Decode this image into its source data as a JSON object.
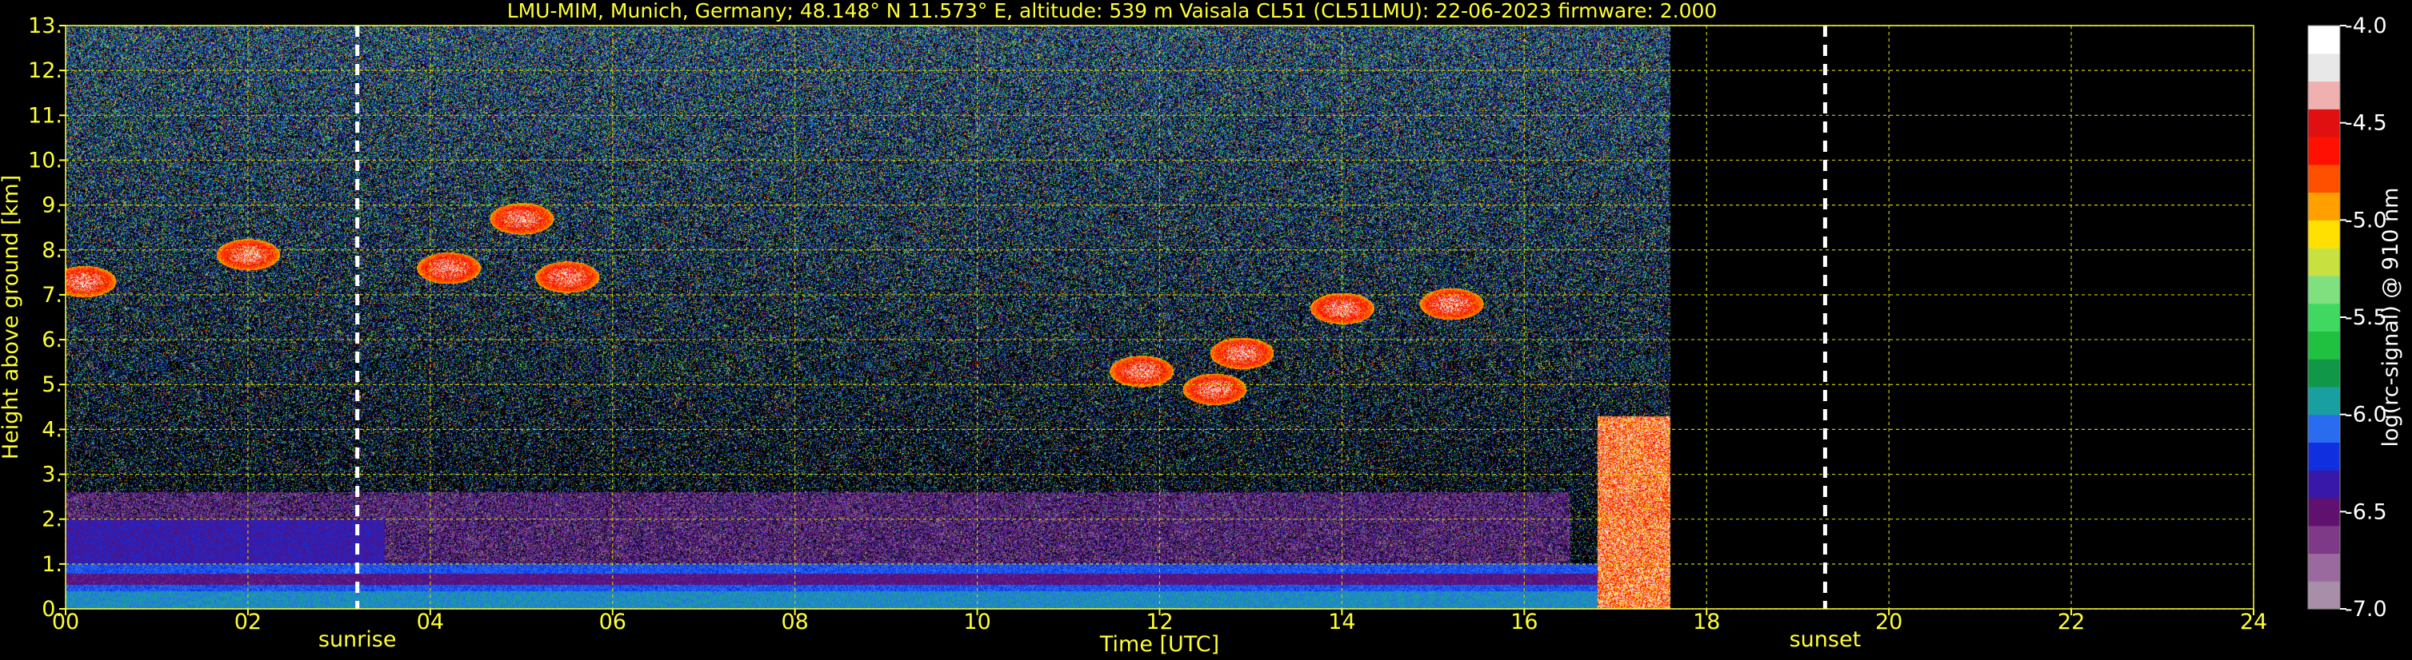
{
  "chart_data": {
    "type": "heatmap",
    "title": "LMU-MIM, Munich, Germany; 48.148° N 11.573° E, altitude: 539 m    Vaisala CL51 (CL51LMU): 22-06-2023    firmware: 2.000",
    "xlabel": "Time [UTC]",
    "ylabel": "Height above ground [km]",
    "xlim": [
      0,
      24
    ],
    "ylim": [
      0,
      13
    ],
    "x_ticks": [
      "00",
      "02",
      "04",
      "06",
      "08",
      "10",
      "12",
      "14",
      "16",
      "18",
      "20",
      "22",
      "24"
    ],
    "x_tick_values": [
      0,
      2,
      4,
      6,
      8,
      10,
      12,
      14,
      16,
      18,
      20,
      22,
      24
    ],
    "y_ticks": [
      "0.",
      "1.",
      "2.",
      "3.",
      "4.",
      "5.",
      "6.",
      "7.",
      "8.",
      "9.",
      "10.",
      "11.",
      "12.",
      "13."
    ],
    "y_tick_values": [
      0,
      1,
      2,
      3,
      4,
      5,
      6,
      7,
      8,
      9,
      10,
      11,
      12,
      13
    ],
    "grid": true,
    "data_end_time": 17.6,
    "markers": [
      {
        "label": "sunrise",
        "x": 3.2
      },
      {
        "label": "sunset",
        "x": 19.3
      }
    ],
    "colorbar": {
      "label": "log(rc-signal) @ 910 nm",
      "range": [
        -7.0,
        -4.0
      ],
      "ticks": [
        "-4.0",
        "-4.5",
        "-5.0",
        "-5.5",
        "-6.0",
        "-6.5",
        "-7.0"
      ],
      "tick_values": [
        -4.0,
        -4.5,
        -5.0,
        -5.5,
        -6.0,
        -6.5,
        -7.0
      ],
      "colors": [
        "#a88ea8",
        "#9a6a9e",
        "#7e3a86",
        "#60106e",
        "#3818a8",
        "#1030e0",
        "#2a6cf0",
        "#18a0a0",
        "#109848",
        "#20c040",
        "#40d860",
        "#80e080",
        "#c8e040",
        "#ffe000",
        "#ffa000",
        "#ff5000",
        "#ff1000",
        "#e01010",
        "#f0b0b0",
        "#e8e8e8",
        "#ffffff"
      ]
    },
    "features": [
      {
        "name": "boundary layer",
        "t0": 0,
        "t1": 17.6,
        "h0": 0,
        "h1": 1.0
      },
      {
        "name": "residual layer",
        "t0": 0,
        "t1": 3.5,
        "h0": 1.0,
        "h1": 2.0
      },
      {
        "name": "cirrus",
        "t": 0.2,
        "h": 7.3
      },
      {
        "name": "cirrus",
        "t": 2.0,
        "h": 7.9
      },
      {
        "name": "cirrus",
        "t": 4.2,
        "h": 7.6
      },
      {
        "name": "cirrus",
        "t": 5.5,
        "h": 7.4
      },
      {
        "name": "cirrus",
        "t": 5.0,
        "h": 8.7
      },
      {
        "name": "cirrus",
        "t": 12.9,
        "h": 5.7
      },
      {
        "name": "cirrus",
        "t": 12.6,
        "h": 4.9
      },
      {
        "name": "cirrus",
        "t": 11.8,
        "h": 5.3
      },
      {
        "name": "cirrus",
        "t": 14.0,
        "h": 6.7
      },
      {
        "name": "cirrus",
        "t": 15.2,
        "h": 6.8
      },
      {
        "name": "precipitation",
        "t0": 16.8,
        "t1": 17.6,
        "h0": 0,
        "h1": 4.3
      }
    ]
  }
}
